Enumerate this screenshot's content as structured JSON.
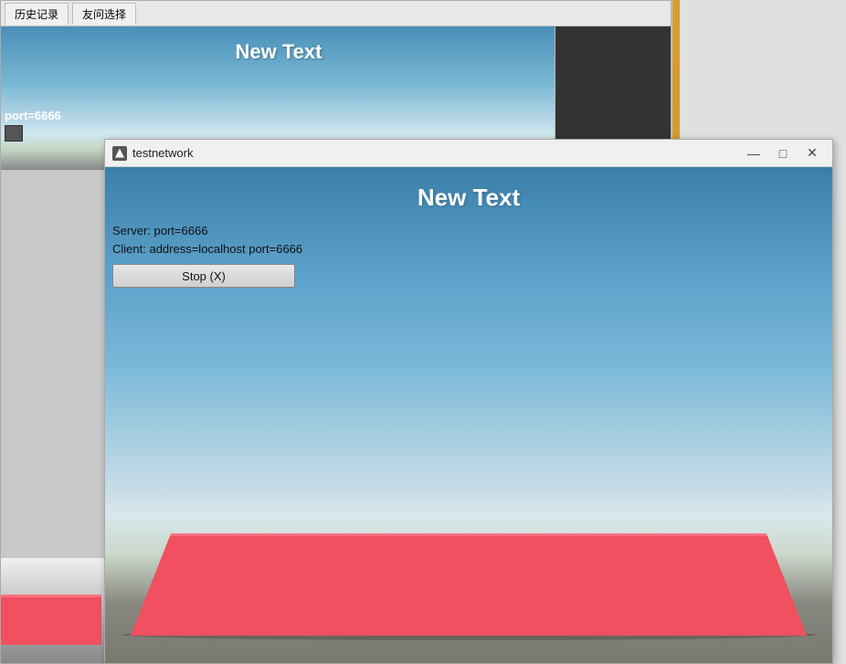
{
  "background_window": {
    "tabs": [
      {
        "label": "历史记录"
      },
      {
        "label": "友问选择"
      }
    ],
    "game_title": "New Text",
    "port_label": "port=6666"
  },
  "front_window": {
    "title": "testnetwork",
    "game_title": "New Text",
    "server_label": "Server: port=6666",
    "client_label": "Client: address=localhost port=6666",
    "stop_button_label": "Stop (X)",
    "titlebar_controls": {
      "minimize": "—",
      "maximize": "□",
      "close": "✕"
    }
  }
}
